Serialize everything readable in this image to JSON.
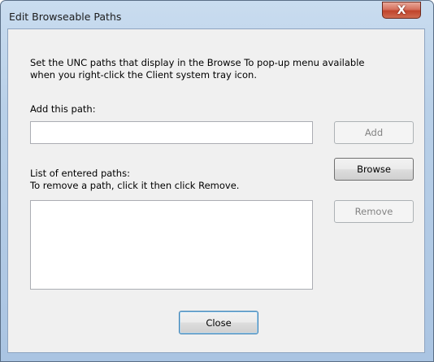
{
  "window": {
    "title": "Edit Browseable Paths",
    "close_glyph": "X"
  },
  "dialog": {
    "description_line1": "Set the UNC paths that display in the Browse To pop-up menu available",
    "description_line2": "when you right-click the Client system tray icon.",
    "add_path_label": "Add this path:",
    "add_path_value": "",
    "list_label": "List of entered paths:",
    "list_hint": "To remove a path, click it then click Remove.",
    "entered_paths": []
  },
  "buttons": {
    "add": "Add",
    "browse": "Browse",
    "remove": "Remove",
    "close": "Close"
  },
  "states": {
    "add_enabled": false,
    "remove_enabled": false,
    "browse_enabled": true,
    "close_enabled": true
  },
  "colors": {
    "frame": "#b9d0e8",
    "client": "#f0f0f0",
    "close_button": "#c0442c",
    "disabled_text": "#838383"
  }
}
